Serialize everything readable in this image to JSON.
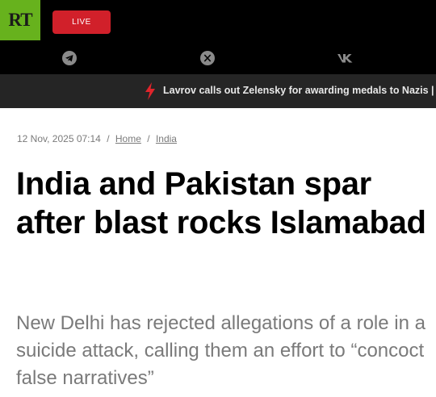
{
  "header": {
    "logo_text": "RT",
    "live_label": "LIVE",
    "social": [
      "telegram-icon",
      "x-icon",
      "vk-icon"
    ],
    "colors": {
      "logo_bg": "#67b21d",
      "live_bg": "#d1202a",
      "ticker_bolt": "#e0242b"
    }
  },
  "ticker": {
    "text": "Lavrov calls out Zelensky for awarding medals to Nazis | R"
  },
  "article": {
    "date": "12 Nov, 2025 07:14",
    "breadcrumb_sep": "/",
    "breadcrumbs": [
      "Home",
      "India"
    ],
    "title": "India and Pakistan spar after blast rocks Islamabad",
    "lead": "New Delhi has rejected allegations of a role in a suicide attack, calling them an effort to “concoct false narratives”"
  }
}
